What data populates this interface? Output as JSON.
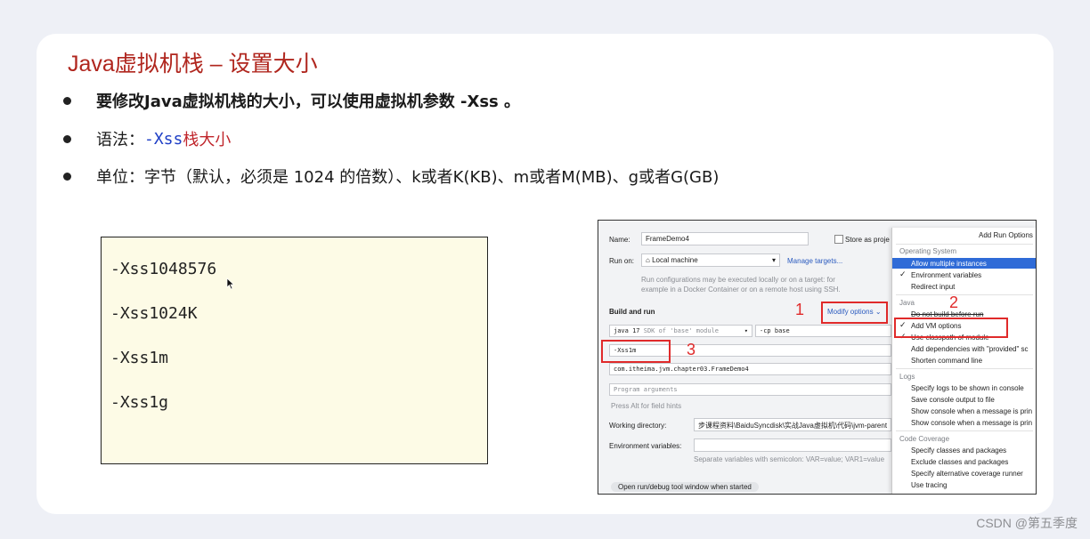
{
  "slide": {
    "title": "Java虚拟机栈 – 设置大小",
    "bullets": {
      "b1": "要修改Java虚拟机栈的大小，可以使用虚拟机参数 -Xss 。",
      "b2_prefix": "语法：",
      "b2_code": "-Xss",
      "b2_suffix": "栈大小",
      "b3": "单位：字节（默认，必须是 1024 的倍数）、k或者K(KB)、m或者M(MB)、g或者G(GB)"
    },
    "examples": [
      "-Xss1048576",
      "-Xss1024K",
      "-Xss1m",
      "-Xss1g"
    ]
  },
  "ide": {
    "name_label": "Name:",
    "name_value": "FrameDemo4",
    "store_label": "Store as proje",
    "run_on_label": "Run on:",
    "run_on_value": "Local machine",
    "manage_targets": "Manage targets...",
    "run_on_hint": "Run configurations may be executed locally or on a target: for example in a Docker Container or on a remote host using SSH.",
    "build_run_label": "Build and run",
    "modify_options": "Modify options",
    "java_select": "java 17",
    "java_select_hint": "SDK of 'base' module",
    "cp_value": "-cp  base",
    "vm_option": "-Xss1m",
    "main_class": "com.itheima.jvm.chapter03.FrameDemo4",
    "program_args_placeholder": "Program arguments",
    "alt_hint": "Press Alt for field hints",
    "working_dir_label": "Working directory:",
    "working_dir_value": "步课程资料\\BaiduSyncdisk\\实战Java虚拟机\\代码\\jvm-parent",
    "env_label": "Environment variables:",
    "env_hint": "Separate variables with semicolon: VAR=value; VAR1=value",
    "open_run_debug": "Open run/debug tool window when started",
    "annotations": [
      "1",
      "2",
      "3"
    ]
  },
  "menu": {
    "title": "Add Run Options",
    "os_section": "Operating System",
    "os_items": [
      "Allow multiple instances",
      "Environment variables",
      "Redirect input"
    ],
    "java_section": "Java",
    "java_items": [
      "Do not build before run",
      "Add VM options",
      "Use classpath of module",
      "Add dependencies with \"provided\" sc",
      "Shorten command line"
    ],
    "logs_section": "Logs",
    "logs_items": [
      "Specify logs to be shown in console",
      "Save console output to file",
      "Show console when a message is prin",
      "Show console when a message is prin"
    ],
    "coverage_section": "Code Coverage",
    "coverage_items": [
      "Specify classes and packages",
      "Exclude classes and packages",
      "Specify alternative coverage runner",
      "Use tracing"
    ],
    "check_glyph": "✓"
  },
  "watermark": "CSDN @第五季度",
  "colors": {
    "title": "#b0261e",
    "code": "#1f3fc6",
    "annotation": "#e02a2a",
    "menu_selected": "#2f6bd7"
  }
}
